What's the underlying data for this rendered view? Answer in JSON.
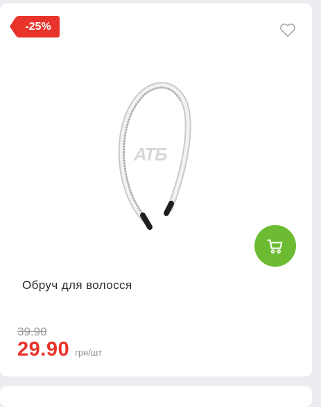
{
  "product": {
    "discount_badge": "-25%",
    "watermark": "АТБ",
    "name": "Обруч для волосся",
    "old_price": "39.90",
    "price": "29.90",
    "unit": "грн/шт"
  },
  "icons": {
    "favorite": "heart-outline-icon",
    "cart": "cart-icon"
  },
  "colors": {
    "accent_red": "#e8332a",
    "cart_green": "#6dbb32",
    "background": "#ebedf0"
  }
}
